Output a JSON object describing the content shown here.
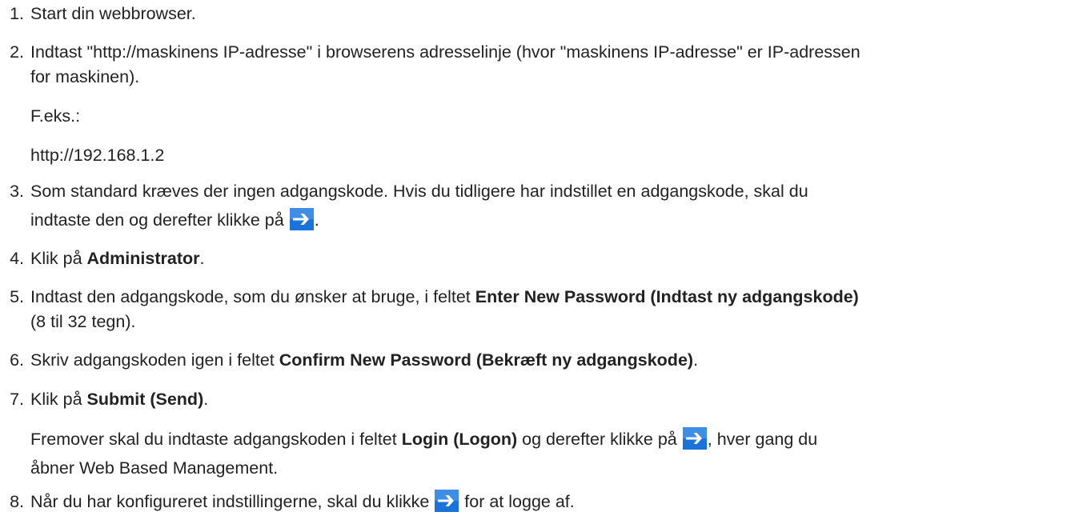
{
  "steps": [
    {
      "num": "1.",
      "text": "Start din webbrowser."
    },
    {
      "num": "2.",
      "line1": "Indtast \"http://maskinens IP-adresse\" i browserens adresselinje (hvor \"maskinens IP-adresse\" er IP-adressen",
      "line2": "for maskinen).",
      "example_label": "F.eks.:",
      "example_value": "http://192.168.1.2"
    },
    {
      "num": "3.",
      "line1": "Som standard kræves der ingen adgangskode. Hvis du tidligere har indstillet en adgangskode, skal du",
      "line2_pre": "indtaste den og derefter klikke på",
      "line2_post": "."
    },
    {
      "num": "4.",
      "pre": "Klik på ",
      "bold": "Administrator",
      "post": "."
    },
    {
      "num": "5.",
      "pre": "Indtast den adgangskode, som du ønsker at bruge, i feltet ",
      "bold": "Enter New Password (Indtast ny adgangskode)",
      "line2": "(8 til 32 tegn)."
    },
    {
      "num": "6.",
      "pre": "Skriv adgangskoden igen i feltet ",
      "bold": "Confirm New Password (Bekræft ny adgangskode)",
      "post": "."
    },
    {
      "num": "7.",
      "pre": "Klik på ",
      "bold": "Submit (Send)",
      "post": ".",
      "note_pre": "Fremover skal du indtaste adgangskoden i feltet ",
      "note_bold": "Login (Logon)",
      "note_mid": " og derefter klikke på ",
      "note_post": ", hver gang du",
      "note_line2": "åbner Web Based Management."
    },
    {
      "num": "8.",
      "pre": "Når du har konfigureret indstillingerne, skal du klikke ",
      "post": " for at logge af."
    }
  ],
  "icons": {
    "arrow": "arrow-right-icon",
    "arrow_color": "#1a73d9"
  }
}
